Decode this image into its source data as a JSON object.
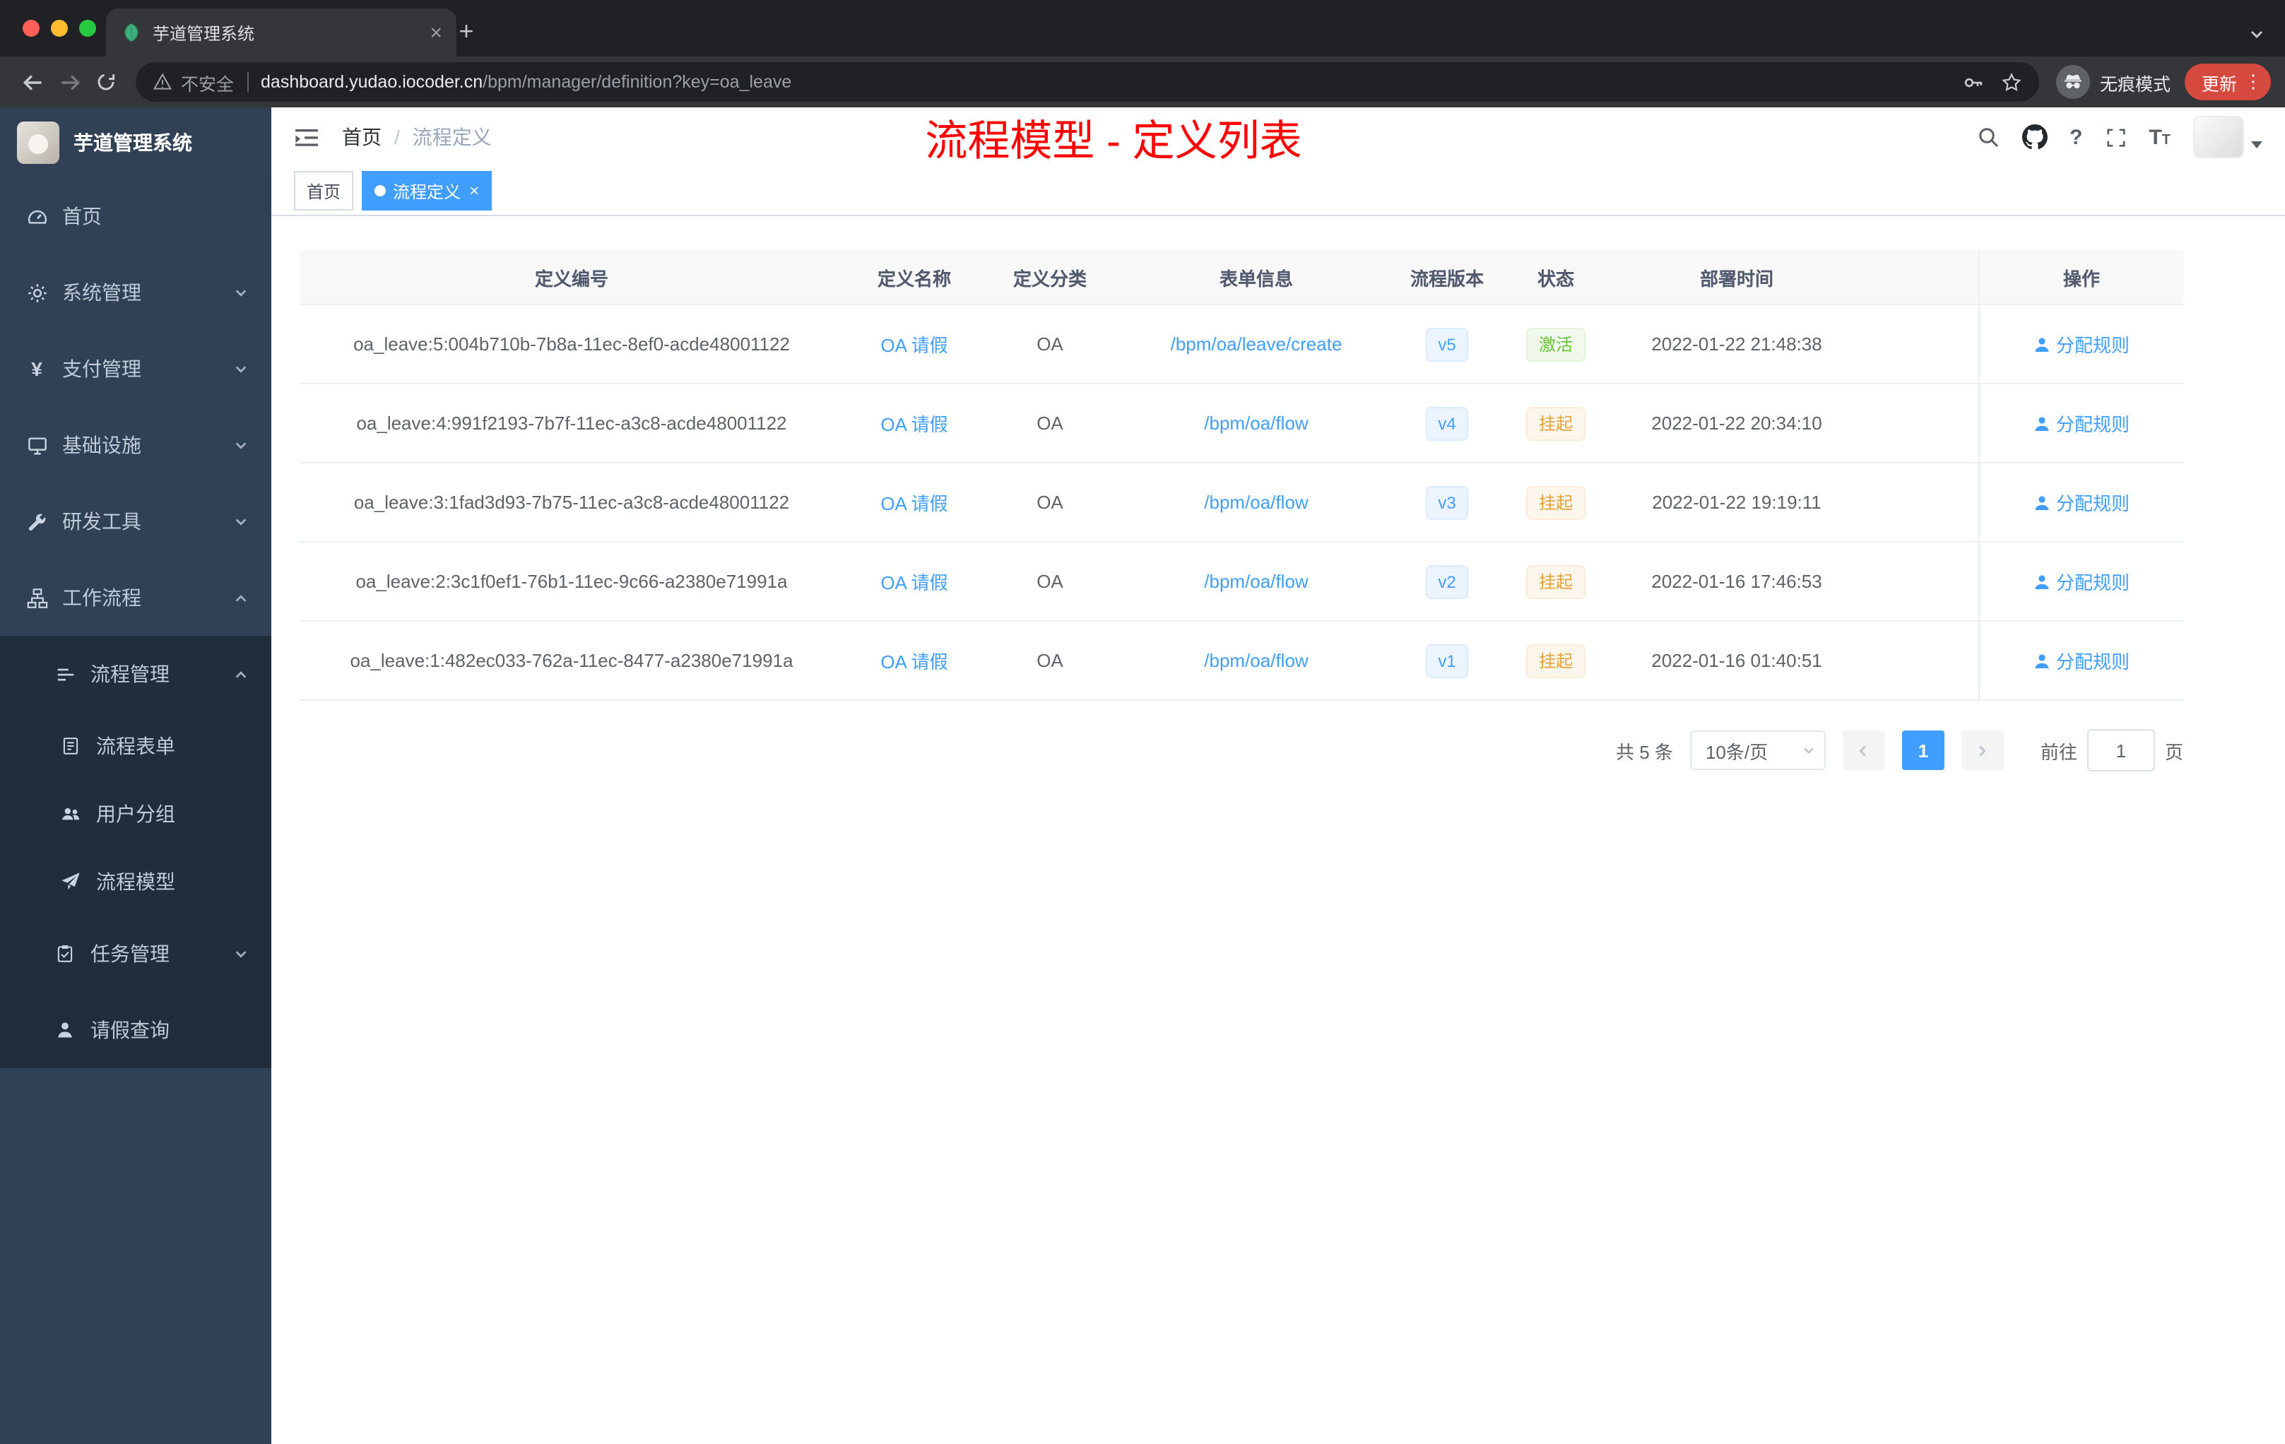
{
  "browser": {
    "tab_title": "芋道管理系统",
    "security_label": "不安全",
    "url_domain": "dashboard.yudao.iocoder.cn",
    "url_path": "/bpm/manager/definition?key=oa_leave",
    "incognito_label": "无痕模式",
    "update_label": "更新"
  },
  "icons": {
    "tab_close": "×",
    "new_tab": "+",
    "menu_dots": "⋮",
    "question": "?",
    "yen": "¥",
    "fontsize_big": "T",
    "fontsize_small": "T",
    "breadcrumb_separator": "/",
    "tag_close": "×",
    "named": [
      "favicon-leaf-icon",
      "tab-search-chevron-icon",
      "back-icon",
      "forward-icon",
      "reload-icon",
      "warning-triangle-icon",
      "key-icon",
      "star-icon",
      "incognito-spy-icon",
      "dashboard-icon",
      "gear-icon",
      "monitor-icon",
      "wrench-icon",
      "workflow-icon",
      "list-icon",
      "form-icon",
      "user-group-icon",
      "paper-plane-icon",
      "task-icon",
      "user-icon",
      "hamburger-icon",
      "search-icon",
      "github-icon",
      "fullscreen-icon",
      "chevron-down-icon",
      "chevron-up-icon"
    ]
  },
  "sidebar": {
    "logo_title": "芋道管理系统",
    "menu": [
      {
        "label": "首页",
        "icon": "dashboard-icon"
      },
      {
        "label": "系统管理",
        "icon": "gear-icon",
        "state": "collapsed"
      },
      {
        "label": "支付管理",
        "icon": "yen-icon",
        "state": "collapsed"
      },
      {
        "label": "基础设施",
        "icon": "monitor-icon",
        "state": "collapsed"
      },
      {
        "label": "研发工具",
        "icon": "wrench-icon",
        "state": "collapsed"
      },
      {
        "label": "工作流程",
        "icon": "workflow-icon",
        "state": "expanded"
      }
    ],
    "workflow_children": [
      {
        "label": "流程管理",
        "icon": "list-icon",
        "state": "expanded"
      },
      {
        "label": "流程表单",
        "icon": "form-icon"
      },
      {
        "label": "用户分组",
        "icon": "user-group-icon"
      },
      {
        "label": "流程模型",
        "icon": "paper-plane-icon"
      },
      {
        "label": "任务管理",
        "icon": "task-icon",
        "state": "collapsed"
      },
      {
        "label": "请假查询",
        "icon": "user-icon"
      }
    ]
  },
  "header": {
    "breadcrumb_home": "首页",
    "breadcrumb_current": "流程定义",
    "annotation": "流程模型 - 定义列表"
  },
  "tags_view": [
    {
      "label": "首页",
      "active": false
    },
    {
      "label": "流程定义",
      "active": true,
      "closable": true
    }
  ],
  "table": {
    "columns": [
      "定义编号",
      "定义名称",
      "定义分类",
      "表单信息",
      "流程版本",
      "状态",
      "部署时间",
      "操作"
    ],
    "action_label": "分配规则",
    "rows": [
      {
        "id": "oa_leave:5:004b710b-7b8a-11ec-8ef0-acde48001122",
        "name": "OA 请假",
        "category": "OA",
        "form": "/bpm/oa/leave/create",
        "version": "v5",
        "status": "激活",
        "status_type": "success",
        "deployed_at": "2022-01-22 21:48:38"
      },
      {
        "id": "oa_leave:4:991f2193-7b7f-11ec-a3c8-acde48001122",
        "name": "OA 请假",
        "category": "OA",
        "form": "/bpm/oa/flow",
        "version": "v4",
        "status": "挂起",
        "status_type": "warning",
        "deployed_at": "2022-01-22 20:34:10"
      },
      {
        "id": "oa_leave:3:1fad3d93-7b75-11ec-a3c8-acde48001122",
        "name": "OA 请假",
        "category": "OA",
        "form": "/bpm/oa/flow",
        "version": "v3",
        "status": "挂起",
        "status_type": "warning",
        "deployed_at": "2022-01-22 19:19:11"
      },
      {
        "id": "oa_leave:2:3c1f0ef1-76b1-11ec-9c66-a2380e71991a",
        "name": "OA 请假",
        "category": "OA",
        "form": "/bpm/oa/flow",
        "version": "v2",
        "status": "挂起",
        "status_type": "warning",
        "deployed_at": "2022-01-16 17:46:53"
      },
      {
        "id": "oa_leave:1:482ec033-762a-11ec-8477-a2380e71991a",
        "name": "OA 请假",
        "category": "OA",
        "form": "/bpm/oa/flow",
        "version": "v1",
        "status": "挂起",
        "status_type": "warning",
        "deployed_at": "2022-01-16 01:40:51"
      }
    ]
  },
  "pagination": {
    "total_label": "共 5 条",
    "page_size_label": "10条/页",
    "current_page": "1",
    "goto_label": "前往",
    "goto_value": "1",
    "goto_unit": "页"
  },
  "colors": {
    "primary": "#409eff",
    "success_text": "#67c23a",
    "warning_text": "#e6a23c",
    "annotation_red": "#fe0000",
    "sidebar_bg": "#304156",
    "submenu_bg": "#1f2d3d"
  }
}
